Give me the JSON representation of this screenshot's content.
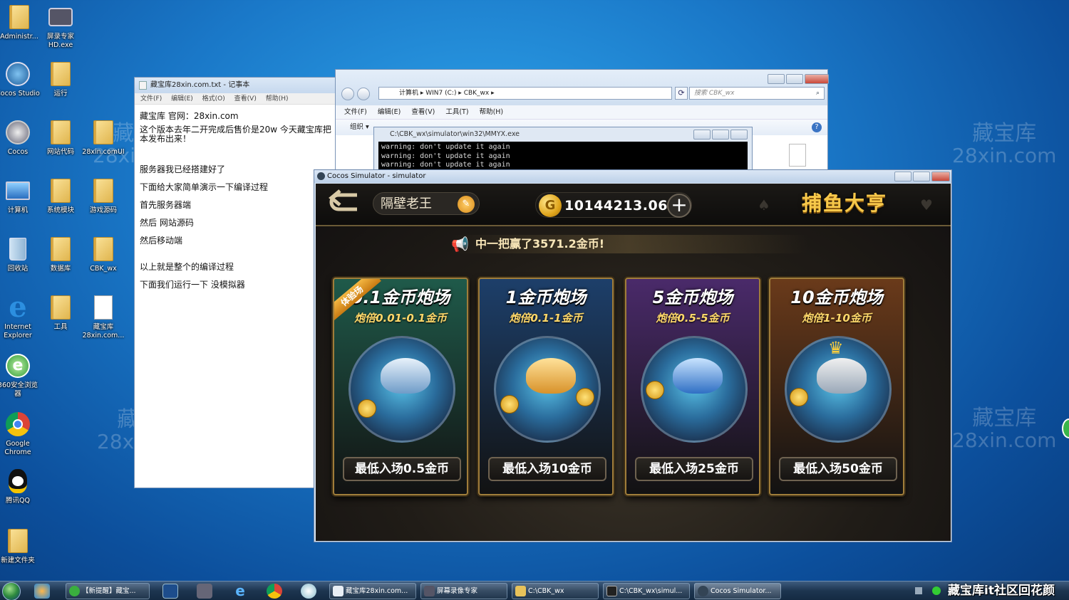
{
  "desktop": {
    "icons": [
      {
        "label": "Administr..."
      },
      {
        "label": "屏录专家HD.exe"
      },
      {
        "label": "Cocos Studio"
      },
      {
        "label": "运行"
      },
      {
        "label": "Cocos"
      },
      {
        "label": "网站代码"
      },
      {
        "label": "28xin.comUI"
      },
      {
        "label": "计算机"
      },
      {
        "label": "系统模块"
      },
      {
        "label": "游戏源码"
      },
      {
        "label": "回收站"
      },
      {
        "label": "数据库"
      },
      {
        "label": "CBK_wx"
      },
      {
        "label": "Internet Explorer"
      },
      {
        "label": "工具"
      },
      {
        "label": "藏宝库28xin.com..."
      },
      {
        "label": "360安全浏览器"
      },
      {
        "label": "Google Chrome"
      },
      {
        "label": "腾讯QQ"
      },
      {
        "label": "新建文件夹"
      }
    ],
    "watermark": {
      "line1": "藏宝库",
      "line2": "28xin.com"
    }
  },
  "notepad": {
    "title": "藏宝库28xin.com.txt - 记事本",
    "menu": [
      "文件(F)",
      "编辑(E)",
      "格式(O)",
      "查看(V)",
      "帮助(H)"
    ],
    "lines": [
      "藏宝库 官网：28xin.com",
      "这个版本去年二开完成后售价是20w 今天藏宝库把",
      "本发布出来！",
      "服务器我已经搭建好了",
      "下面给大家简单演示一下编译过程",
      "首先服务器端",
      "然后    网站源码",
      "然后移动端",
      "以上就是整个的编译过程",
      "下面我们运行一下  没模拟器"
    ]
  },
  "explorer": {
    "address": "计算机  ▸  WIN7 (C:)  ▸  CBK_wx  ▸",
    "search_placeholder": "搜索 CBK_wx",
    "menu": [
      "文件(F)",
      "编辑(E)",
      "查看(V)",
      "工具(T)",
      "帮助(H)"
    ],
    "organize": "组织 ▾"
  },
  "console": {
    "title": "C:\\CBK_wx\\simulator\\win32\\MMYX.exe",
    "lines": [
      "warning: don't update it again",
      "warning: don't update it again",
      "warning: don't update it again"
    ]
  },
  "simulator": {
    "title": "Cocos Simulator - simulator",
    "game": {
      "player_name": "隔壁老王",
      "coins": "10144213.06",
      "title": "捕鱼大亨",
      "marquee": "中一把赢了3571.2金币!",
      "rooms": [
        {
          "name": "0.1金币炮场",
          "range": "炮倍0.01-0.1金币",
          "entry": "最低入场0.5金币",
          "ribbon": "体验场",
          "color": "#1f5a4a"
        },
        {
          "name": "1金币炮场",
          "range": "炮倍0.1-1金币",
          "entry": "最低入场10金币",
          "ribbon": "",
          "color": "#1d3f6a"
        },
        {
          "name": "5金币炮场",
          "range": "炮倍0.5-5金币",
          "entry": "最低入场25金币",
          "ribbon": "",
          "color": "#4a2a6a"
        },
        {
          "name": "10金币炮场",
          "range": "炮倍1-10金币",
          "entry": "最低入场50金币",
          "ribbon": "",
          "color": "#6a3a1a"
        }
      ]
    }
  },
  "taskbar": {
    "items": [
      "【新提醒】藏宝...",
      "藏宝库28xin.com...",
      "屏幕录像专家",
      "C:\\CBK_wx",
      "C:\\CBK_wx\\simul...",
      "Cocos Simulator..."
    ],
    "overlay_text": "藏宝库it社区回花颜"
  }
}
